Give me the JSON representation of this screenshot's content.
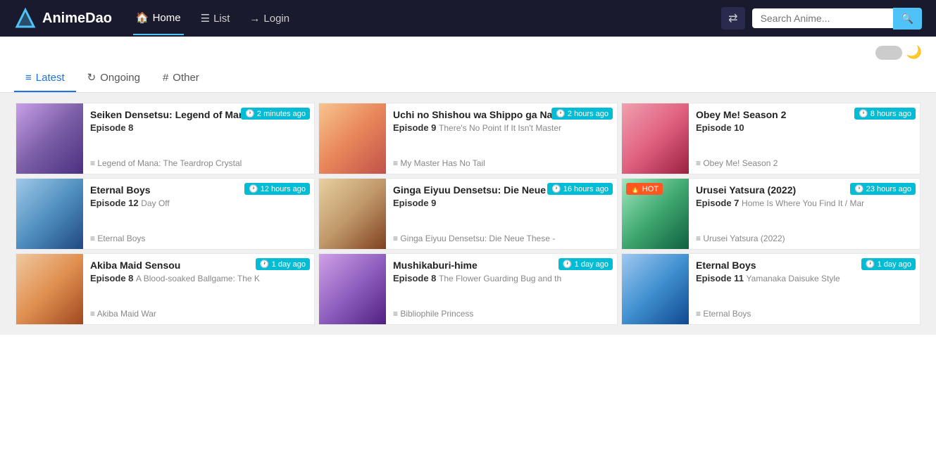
{
  "brand": {
    "name": "AnimeDao",
    "logo_char": "✈"
  },
  "nav": {
    "links": [
      {
        "label": "Home",
        "active": true,
        "icon": "🏠"
      },
      {
        "label": "List",
        "icon": "☰"
      },
      {
        "label": "Login",
        "icon": "→"
      }
    ],
    "shuffle_icon": "⇄",
    "search_placeholder": "Search Anime...",
    "search_icon": "🔍"
  },
  "tabs": [
    {
      "label": "Latest",
      "icon": "≡",
      "active": true
    },
    {
      "label": "Ongoing",
      "icon": "↻",
      "active": false
    },
    {
      "label": "Other",
      "icon": "⊞",
      "active": false
    }
  ],
  "cards": [
    {
      "id": 1,
      "title": "Seiken Densetsu: Legend of Mana -T",
      "episode": "Episode 8",
      "episode_sub": "",
      "series": "Legend of Mana: The Teardrop Crystal",
      "time": "2 minutes ago",
      "thumb_class": "thumb-1",
      "hot": false
    },
    {
      "id": 2,
      "title": "Uchi no Shishou wa Shippo ga Nai",
      "episode": "Episode 9",
      "episode_sub": "There's No Point If It Isn't Master",
      "series": "My Master Has No Tail",
      "time": "2 hours ago",
      "thumb_class": "thumb-2",
      "hot": false
    },
    {
      "id": 3,
      "title": "Obey Me! Season 2",
      "episode": "Episode 10",
      "episode_sub": "",
      "series": "Obey Me! Season 2",
      "time": "8 hours ago",
      "thumb_class": "thumb-3",
      "hot": false
    },
    {
      "id": 4,
      "title": "Eternal Boys",
      "episode": "Episode 12",
      "episode_sub": "Day Off",
      "series": "Eternal Boys",
      "time": "12 hours ago",
      "thumb_class": "thumb-4",
      "hot": false
    },
    {
      "id": 5,
      "title": "Ginga Eiyuu Densetsu: Die Neue The",
      "episode": "Episode 9",
      "episode_sub": "",
      "series": "Ginga Eiyuu Densetsu: Die Neue These -",
      "time": "16 hours ago",
      "thumb_class": "thumb-5",
      "hot": false
    },
    {
      "id": 6,
      "title": "Urusei Yatsura (2022)",
      "episode": "Episode 7",
      "episode_sub": "Home Is Where You Find It / Mar",
      "series": "Urusei Yatsura (2022)",
      "time": "23 hours ago",
      "thumb_class": "thumb-6",
      "hot": true
    },
    {
      "id": 7,
      "title": "Akiba Maid Sensou",
      "episode": "Episode 8",
      "episode_sub": "A Blood-soaked Ballgame: The K",
      "series": "Akiba Maid War",
      "time": "1 day ago",
      "thumb_class": "thumb-7",
      "hot": false
    },
    {
      "id": 8,
      "title": "Mushikaburi-hime",
      "episode": "Episode 8",
      "episode_sub": "The Flower Guarding Bug and th",
      "series": "Bibliophile Princess",
      "time": "1 day ago",
      "thumb_class": "thumb-8",
      "hot": false
    },
    {
      "id": 9,
      "title": "Eternal Boys",
      "episode": "Episode 11",
      "episode_sub": "Yamanaka Daisuke Style",
      "series": "Eternal Boys",
      "time": "1 day ago",
      "thumb_class": "thumb-9",
      "hot": false
    }
  ],
  "hot_label": "HOT",
  "clock_symbol": "🕐",
  "list_symbol": "≡"
}
